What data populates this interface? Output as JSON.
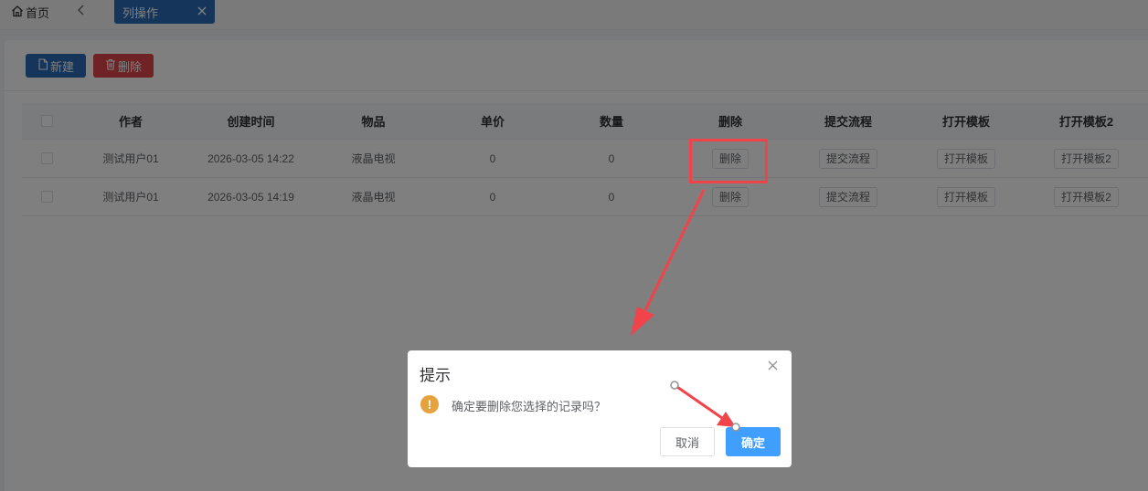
{
  "tabbar": {
    "home_label": "首页",
    "active_tab_label": "列操作"
  },
  "toolbar": {
    "new_label": "新建",
    "delete_label": "删除"
  },
  "table": {
    "headers": [
      "作者",
      "创建时间",
      "物品",
      "单价",
      "数量",
      "删除",
      "提交流程",
      "打开模板",
      "打开模板2"
    ],
    "rows": [
      {
        "author": "测试用户01",
        "created": "2026-03-05 14:22",
        "item": "液晶电视",
        "price": "0",
        "qty": "0",
        "delete_btn": "删除",
        "submit_btn": "提交流程",
        "open_btn": "打开模板",
        "open2_btn": "打开模板2"
      },
      {
        "author": "测试用户01",
        "created": "2026-03-05 14:19",
        "item": "液晶电视",
        "price": "0",
        "qty": "0",
        "delete_btn": "删除",
        "submit_btn": "提交流程",
        "open_btn": "打开模板",
        "open2_btn": "打开模板2"
      }
    ]
  },
  "dialog": {
    "title": "提示",
    "warning_icon_glyph": "!",
    "message": "确定要删除您选择的记录吗？",
    "cancel_label": "取消",
    "confirm_label": "确定"
  },
  "colors": {
    "primary": "#2b6ab4",
    "danger": "#e0474b",
    "confirm": "#409eff",
    "warning": "#e6a23c",
    "annotation": "#f0434a"
  },
  "icons": [
    "home-icon",
    "chevron-left-icon",
    "close-icon",
    "file-icon",
    "trash-icon",
    "warning-icon"
  ]
}
